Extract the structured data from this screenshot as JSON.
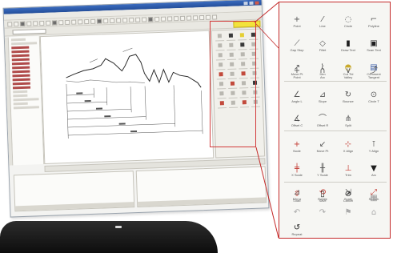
{
  "window": {
    "title": ""
  },
  "colors": {
    "accent_red": "#c42a2a",
    "titlebar_blue": "#2b5aa8",
    "highlight_yellow": "#f3e33b",
    "device_black": "#111111"
  },
  "palette_groups": [
    {
      "items": [
        {
          "icon": "cross-icon",
          "glyph": "+",
          "label": "Point"
        },
        {
          "icon": "line-icon",
          "glyph": "⁄",
          "label": "Line"
        },
        {
          "icon": "circle-icon",
          "glyph": "◌",
          "label": "Circle"
        },
        {
          "icon": "polyline-icon",
          "glyph": "⌐",
          "label": "Polyline"
        },
        {
          "icon": "offset-icon",
          "glyph": "⟋",
          "label": "Gap Stop"
        },
        {
          "icon": "shape-icon",
          "glyph": "◇",
          "label": "Fillet"
        },
        {
          "icon": "block-icon",
          "glyph": "▮",
          "label": "Draw Text"
        },
        {
          "icon": "monitor-icon",
          "glyph": "▣",
          "label": "Scan Text"
        },
        {
          "icon": "move-icon",
          "glyph": "↗",
          "label": "Move Pt"
        },
        {
          "icon": "dimension-icon",
          "glyph": "⌇",
          "label": "Dim"
        },
        {
          "icon": "car-icon",
          "glyph": "◓",
          "label": "Cut Tbl"
        },
        {
          "icon": "comment-icon",
          "glyph": "▤",
          "label": "Comment"
        }
      ]
    },
    {
      "items": [
        {
          "icon": "plus-icon",
          "glyph": "+",
          "label": "Point"
        },
        {
          "icon": "arc-icon",
          "glyph": "∩",
          "label": "Arc"
        },
        {
          "icon": "vee-icon",
          "glyph": "∨",
          "label": "Valley"
        },
        {
          "icon": "tangent-icon",
          "glyph": "⤴",
          "label": "Tangent"
        },
        {
          "icon": "angle-icon",
          "glyph": "∠",
          "label": "Angle L"
        },
        {
          "icon": "slope-icon",
          "glyph": "⊿",
          "label": "Slope"
        },
        {
          "icon": "bounce-icon",
          "glyph": "↻",
          "label": "Bounce"
        },
        {
          "icon": "circle-tangent-icon",
          "glyph": "⊙",
          "label": "Circle T"
        },
        {
          "icon": "offset-angle-icon",
          "glyph": "∡",
          "label": "Offset C"
        },
        {
          "icon": "offset-arc-icon",
          "glyph": "⌒",
          "label": "Offset R"
        },
        {
          "icon": "split-icon",
          "glyph": "⋔",
          "label": "Split"
        }
      ]
    },
    {
      "items": [
        {
          "icon": "node-icon",
          "glyph": "+",
          "label": "Node"
        },
        {
          "icon": "move-node-icon",
          "glyph": "↙",
          "label": "Move Pt"
        },
        {
          "icon": "x-align-icon",
          "glyph": "⊹",
          "label": "X Align"
        },
        {
          "icon": "y-align-icon",
          "glyph": "⊺",
          "label": "Y Align"
        },
        {
          "icon": "x-scale-icon",
          "glyph": "╪",
          "label": "X Scale"
        },
        {
          "icon": "y-scale-icon",
          "glyph": "╫",
          "label": "Y Scale"
        },
        {
          "icon": "trim-icon",
          "glyph": "⊥",
          "label": "Trim"
        },
        {
          "icon": "arrow-down-icon",
          "glyph": "▼",
          "label": "Arc"
        },
        {
          "icon": "mirror-icon",
          "glyph": "⊿",
          "label": "Mirror"
        },
        {
          "icon": "rotate-icon",
          "glyph": "⟲",
          "label": "Rotate"
        },
        {
          "icon": "scale-icon",
          "glyph": "⇲",
          "label": "Scale"
        },
        {
          "icon": "stretch-icon",
          "glyph": "⤢",
          "label": "Stretch"
        }
      ]
    },
    {
      "items": [
        {
          "icon": "upload-icon",
          "glyph": "⇧",
          "label": "Load"
        },
        {
          "icon": "save-icon",
          "glyph": "▯",
          "label": "Save"
        },
        {
          "icon": "cancel-icon",
          "glyph": "⊘",
          "label": "Cancel"
        },
        {
          "icon": "grid-icon",
          "glyph": "▦",
          "label": ""
        },
        {
          "icon": "undo-icon",
          "glyph": "↶",
          "label": ""
        },
        {
          "icon": "redo-icon",
          "glyph": "↷",
          "label": ""
        },
        {
          "icon": "flag-icon",
          "glyph": "⚑",
          "label": ""
        },
        {
          "icon": "tag-icon",
          "glyph": "⌂",
          "label": ""
        },
        {
          "icon": "repeat-icon",
          "glyph": "↺",
          "label": "Repeat"
        }
      ]
    }
  ]
}
